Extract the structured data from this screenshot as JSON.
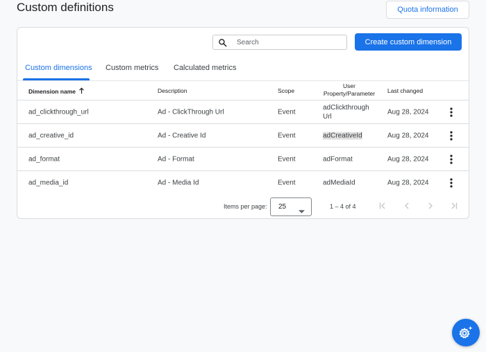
{
  "page": {
    "title": "Custom definitions"
  },
  "header": {
    "quota_label": "Quota information"
  },
  "toolbar": {
    "search_placeholder": "Search",
    "search_icon": "search-icon",
    "create_label": "Create custom dimension"
  },
  "tabs": [
    {
      "label": "Custom dimensions",
      "active": true
    },
    {
      "label": "Custom metrics",
      "active": false
    },
    {
      "label": "Calculated metrics",
      "active": false
    }
  ],
  "table": {
    "columns": {
      "name": "Dimension name",
      "description": "Description",
      "scope": "Scope",
      "user_property_line1": "User",
      "user_property_line2": "Property/Parameter",
      "last_changed": "Last changed"
    },
    "sort_icon": "arrow-up-icon",
    "rows": [
      {
        "name": "ad_clickthrough_url",
        "description": "Ad - ClickThrough Url",
        "scope": "Event",
        "parameter": "adClickthroughUrl",
        "last_changed": "Aug 28, 2024"
      },
      {
        "name": "ad_creative_id",
        "description": "Ad - Creative Id",
        "scope": "Event",
        "parameter": "adCreativeId",
        "last_changed": "Aug 28, 2024"
      },
      {
        "name": "ad_format",
        "description": "Ad - Format",
        "scope": "Event",
        "parameter": "adFormat",
        "last_changed": "Aug 28, 2024"
      },
      {
        "name": "ad_media_id",
        "description": "Ad - Media Id",
        "scope": "Event",
        "parameter": "adMediaId",
        "last_changed": "Aug 28, 2024"
      }
    ],
    "row_menu_icon": "more-vert-icon"
  },
  "pagination": {
    "items_per_page_label": "Items per page:",
    "items_per_page_value": "25",
    "range": "1 – 4 of 4",
    "icons": [
      "first-page-icon",
      "previous-page-icon",
      "next-page-icon",
      "last-page-icon"
    ]
  },
  "fab": {
    "icon": "settings-sparkle-icon"
  },
  "colors": {
    "accent": "#1a73e8",
    "background": "#f8f9fb",
    "border": "#dadce0"
  }
}
